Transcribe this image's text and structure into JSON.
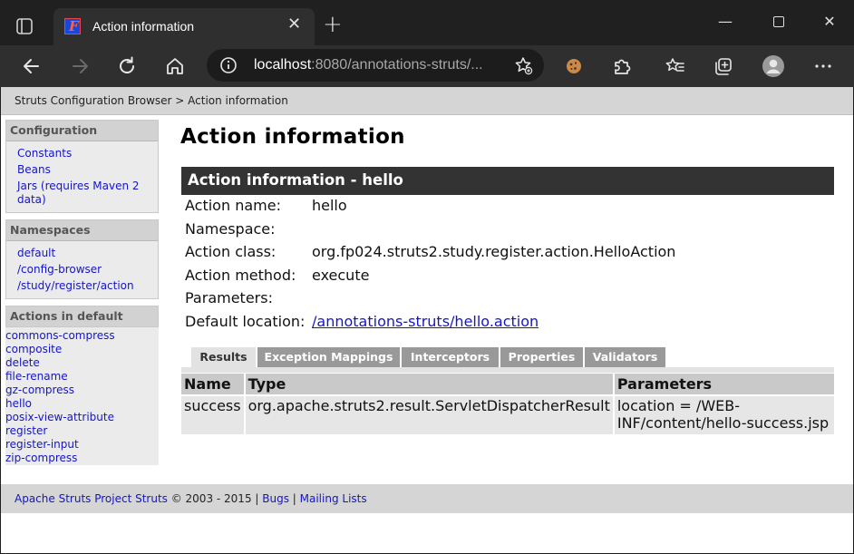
{
  "browser": {
    "tab_title": "Action information",
    "address_host": "localhost",
    "address_rest": ":8080/annotations-struts/..."
  },
  "page": {
    "breadcrumb": "Struts Configuration Browser > Action information",
    "title": "Action information",
    "sidebar": {
      "configuration": {
        "heading": "Configuration",
        "items": [
          "Constants",
          "Beans",
          "Jars (requires Maven 2 data)"
        ]
      },
      "namespaces": {
        "heading": "Namespaces",
        "items": [
          "default",
          "/config-browser",
          "/study/register/action"
        ]
      },
      "actions": {
        "heading": "Actions in default",
        "items": [
          "commons-compress",
          "composite",
          "delete",
          "file-rename",
          "gz-compress",
          "hello",
          "posix-view-attribute",
          "register",
          "register-input",
          "zip-compress"
        ]
      }
    },
    "info_bar": "Action information - hello",
    "info": [
      {
        "label": "Action name:",
        "value": "hello"
      },
      {
        "label": "Namespace:",
        "value": ""
      },
      {
        "label": "Action class:",
        "value": "org.fp024.struts2.study.register.action.HelloAction"
      },
      {
        "label": "Action method:",
        "value": "execute"
      },
      {
        "label": "Parameters:",
        "value": ""
      },
      {
        "label": "Default location:",
        "value": "/annotations-struts/hello.action"
      }
    ],
    "tabs": [
      "Results",
      "Exception Mappings",
      "Interceptors",
      "Properties",
      "Validators"
    ],
    "results": {
      "headers": [
        "Name",
        "Type",
        "Parameters"
      ],
      "rows": [
        {
          "name": "success",
          "type": "org.apache.struts2.result.ServletDispatcherResult",
          "params_line1": "location = /WEB-",
          "params_line2": "INF/content/hello-success.jsp"
        }
      ]
    },
    "footer": {
      "link1": "Apache Struts Project Struts",
      "copyright": " © 2003 - 2015 | ",
      "link2": "Bugs",
      "sep": " | ",
      "link3": "Mailing Lists"
    }
  }
}
